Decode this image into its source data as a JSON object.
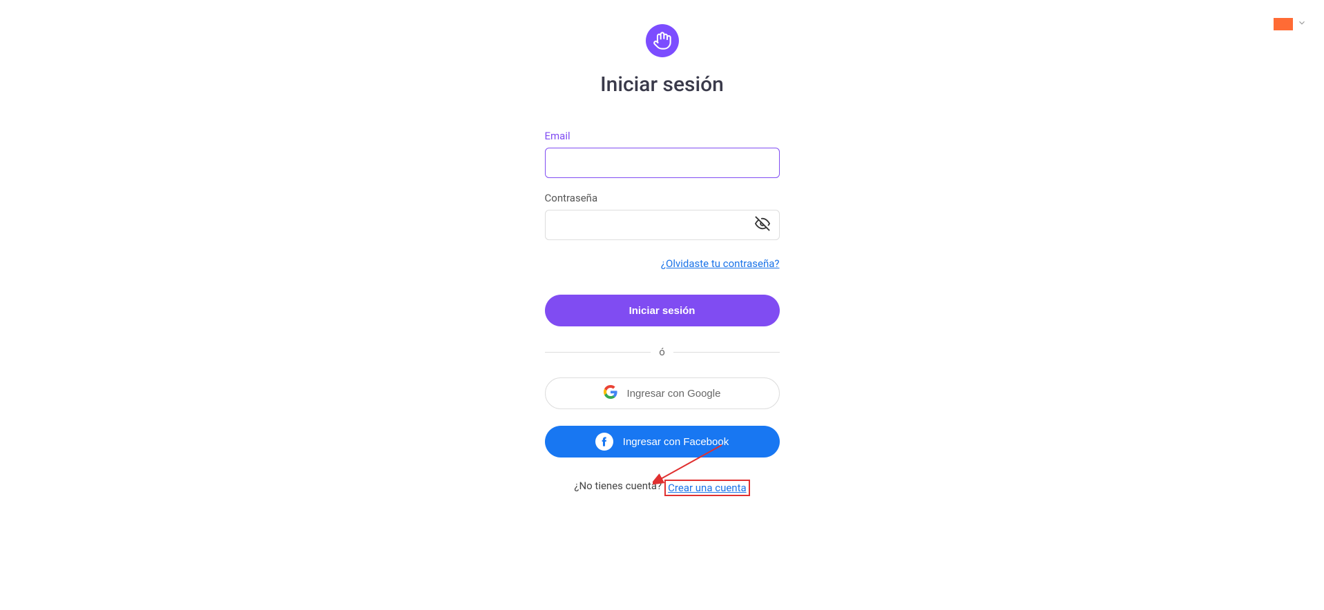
{
  "page": {
    "title": "Iniciar sesión"
  },
  "form": {
    "email_label": "Email",
    "password_label": "Contraseña",
    "forgot_password": "¿Olvidaste tu contraseña?",
    "submit_label": "Iniciar sesión",
    "divider_text": "ó",
    "google_label": "Ingresar con Google",
    "facebook_label": "Ingresar con Facebook",
    "no_account_text": "¿No tienes cuenta?",
    "create_account_link": "Crear una cuenta"
  }
}
